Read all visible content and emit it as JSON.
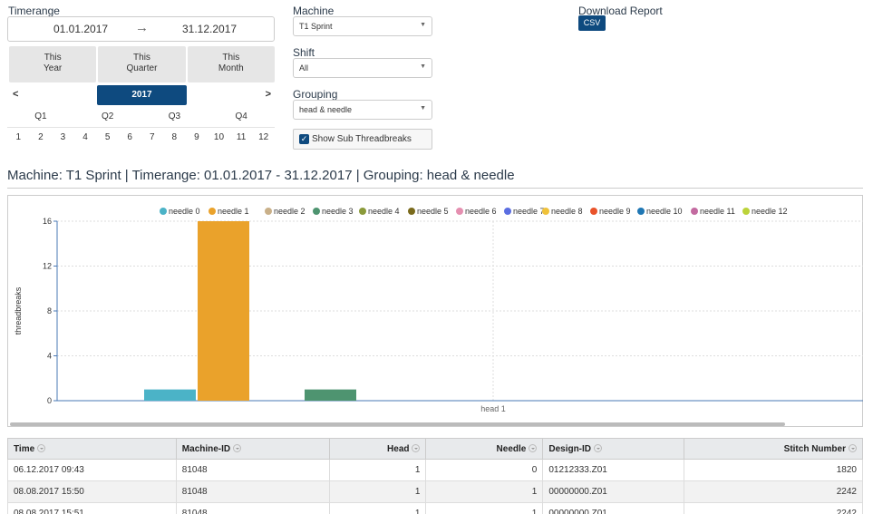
{
  "filters": {
    "timerange_label": "Timerange",
    "date_from": "01.01.2017",
    "date_arrow": "→",
    "date_to": "31.12.2017",
    "quick_buttons": [
      {
        "line1": "This",
        "line2": "Year"
      },
      {
        "line1": "This",
        "line2": "Quarter"
      },
      {
        "line1": "This",
        "line2": "Month"
      }
    ],
    "prev": "<",
    "year": "2017",
    "next": ">",
    "quarters": [
      "Q1",
      "Q2",
      "Q3",
      "Q4"
    ],
    "months": [
      "1",
      "2",
      "3",
      "4",
      "5",
      "6",
      "7",
      "8",
      "9",
      "10",
      "11",
      "12"
    ],
    "machine_label": "Machine",
    "machine_value": "T1 Sprint",
    "shift_label": "Shift",
    "shift_value": "All",
    "grouping_label": "Grouping",
    "grouping_value": "head & needle",
    "sub_threadbreaks_label": "Show Sub Threadbreaks",
    "sub_threadbreaks_checked": true,
    "download_label": "Download Report",
    "csv_label": "CSV"
  },
  "heading": "Machine: T1 Sprint | Timerange: 01.01.2017 - 31.12.2017 | Grouping: head & needle",
  "chart_data": {
    "type": "bar",
    "categories": [
      "head 1"
    ],
    "ylabel": "threadbreaks",
    "xlabel": "",
    "ylim": [
      0,
      16
    ],
    "yticks": [
      0,
      4,
      8,
      12,
      16
    ],
    "grid": true,
    "legend_position": "top",
    "series": [
      {
        "name": "needle 0",
        "values": [
          1
        ],
        "color": "#4bb3c7"
      },
      {
        "name": "needle 1",
        "values": [
          16
        ],
        "color": "#eaa22b"
      },
      {
        "name": "needle 2",
        "values": [
          0
        ],
        "color": "#c9b089"
      },
      {
        "name": "needle 3",
        "values": [
          1
        ],
        "color": "#4e9470"
      },
      {
        "name": "needle 4",
        "values": [
          0
        ],
        "color": "#8a9a3a"
      },
      {
        "name": "needle 5",
        "values": [
          0
        ],
        "color": "#7a6a1c"
      },
      {
        "name": "needle 6",
        "values": [
          0
        ],
        "color": "#e58fb0"
      },
      {
        "name": "needle 7",
        "values": [
          0
        ],
        "color": "#5b6ee1"
      },
      {
        "name": "needle 8",
        "values": [
          0
        ],
        "color": "#f0c23a"
      },
      {
        "name": "needle 9",
        "values": [
          0
        ],
        "color": "#e9532a"
      },
      {
        "name": "needle 10",
        "values": [
          0
        ],
        "color": "#1f77b4"
      },
      {
        "name": "needle 11",
        "values": [
          0
        ],
        "color": "#c36aa0"
      },
      {
        "name": "needle 12",
        "values": [
          0
        ],
        "color": "#bcd33a"
      }
    ]
  },
  "table": {
    "columns": [
      "Time",
      "Machine-ID",
      "Head",
      "Needle",
      "Design-ID",
      "Stitch Number"
    ],
    "rows": [
      [
        "06.12.2017 09:43",
        "81048",
        "1",
        "0",
        "01212333.Z01",
        "1820"
      ],
      [
        "08.08.2017 15:50",
        "81048",
        "1",
        "1",
        "00000000.Z01",
        "2242"
      ],
      [
        "08.08.2017 15:51",
        "81048",
        "1",
        "1",
        "00000000.Z01",
        "2242"
      ]
    ]
  }
}
